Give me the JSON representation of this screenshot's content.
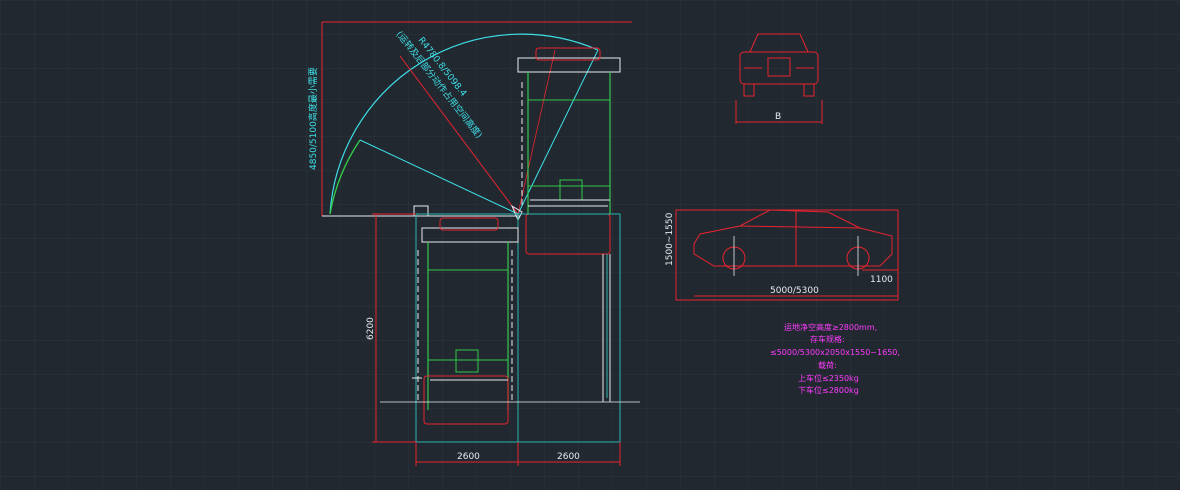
{
  "dimensions": {
    "width_left": "2600",
    "width_right": "2600",
    "height_total": "6200",
    "car_front_width": "B",
    "car_side_length": "5000/5300",
    "car_side_height": "1500~1550",
    "car_side_overhang": "1100"
  },
  "arc_labels": {
    "vertical": "4850/5100高度最小需要",
    "radius": "R4780.8/5098.4",
    "radius_note": "(运转及后部分动作占用空间高度)"
  },
  "notes": [
    "运地净空高度≥2800mm,",
    "存车规格:",
    "≤5000/5300x2050x1550~1650,",
    "载荷:",
    "上车位≤2350kg",
    "下车位≤2800kg"
  ],
  "colors": {
    "background": "#212830",
    "grid": "#2b333c",
    "red": "#e8242f",
    "green": "#34c94a",
    "cyan": "#3fe0e8",
    "white": "#e8ecef",
    "magenta": "#ff3cff",
    "teal": "#2ab5b0"
  }
}
